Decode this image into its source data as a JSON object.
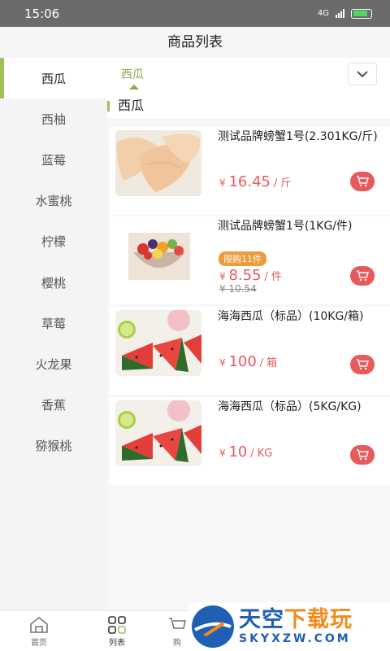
{
  "status_bar": {
    "time": "15:06",
    "network": "4G"
  },
  "header": {
    "title": "商品列表"
  },
  "sidebar": {
    "items": [
      {
        "label": "西瓜"
      },
      {
        "label": "西柚"
      },
      {
        "label": "蓝莓"
      },
      {
        "label": "水蜜桃"
      },
      {
        "label": "柠檬"
      },
      {
        "label": "樱桃"
      },
      {
        "label": "草莓"
      },
      {
        "label": "火龙果"
      },
      {
        "label": "香蕉"
      },
      {
        "label": "猕猴桃"
      }
    ]
  },
  "sub_tabs": {
    "active": "西瓜"
  },
  "section": {
    "title": "西瓜"
  },
  "products": [
    {
      "name": "测试品牌螃蟹1号(2.301KG/斤)",
      "currency": "¥",
      "price": "16.45",
      "unit": "/ 斤",
      "image": "chicken-wings"
    },
    {
      "name": "测试品牌螃蟹1号(1KG/件)",
      "badge": "限购11件",
      "currency": "¥",
      "price": "8.55",
      "unit": "/ 件",
      "original_price": "¥ 10.54",
      "image": "fruit-salad"
    },
    {
      "name": "海海西瓜（标品）(10KG/箱)",
      "currency": "¥",
      "price": "100",
      "unit": "/ 箱",
      "image": "watermelon-slices"
    },
    {
      "name": "海海西瓜（标品）(5KG/KG)",
      "currency": "¥",
      "price": "10",
      "unit": "/ KG",
      "image": "watermelon-slices"
    }
  ],
  "tabbar": {
    "items": [
      {
        "label": "首页",
        "icon": "home-icon"
      },
      {
        "label": "列表",
        "icon": "grid-icon"
      },
      {
        "label": "购",
        "icon": "cart-icon"
      }
    ]
  },
  "watermark": {
    "brand_a": "天空",
    "brand_b": "下载玩",
    "domain": "SKYXZW.COM"
  },
  "colors": {
    "accent_green": "#9dc25a",
    "price_red": "#e8595c",
    "badge_orange": "#ee9c3a"
  }
}
